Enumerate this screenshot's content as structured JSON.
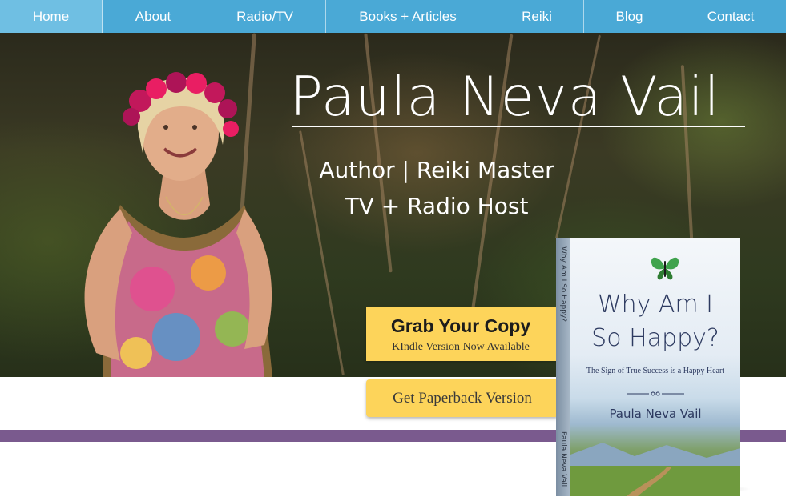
{
  "nav": {
    "items": [
      {
        "label": "Home",
        "active": true
      },
      {
        "label": "About"
      },
      {
        "label": "Radio/TV"
      },
      {
        "label": "Books + Articles"
      },
      {
        "label": "Reiki"
      },
      {
        "label": "Blog"
      },
      {
        "label": "Contact"
      }
    ]
  },
  "hero": {
    "title": "Paula Neva Vail",
    "subtitle_line1": "Author | Reiki Master",
    "subtitle_line2": "TV + Radio Host"
  },
  "cta": {
    "grab_title": "Grab Your Copy",
    "grab_sub": "KIndle Version Now Available",
    "paperback_label": "Get Paperback Version"
  },
  "book": {
    "spine_title": "Why Am I So Happy?",
    "spine_author": "Paula Neva Vail",
    "cover_title_line1": "Why Am I",
    "cover_title_line2": "So Happy?",
    "cover_tagline": "The Sign of True Success is a Happy Heart",
    "cover_author": "Paula Neva Vail",
    "icon": "butterfly-icon"
  },
  "colors": {
    "nav_bg": "#4aa9d6",
    "nav_active": "#6fbfe3",
    "cta_yellow": "#fdd45a",
    "band_purple": "#7a5a8e",
    "cover_text": "#2d3a60"
  }
}
